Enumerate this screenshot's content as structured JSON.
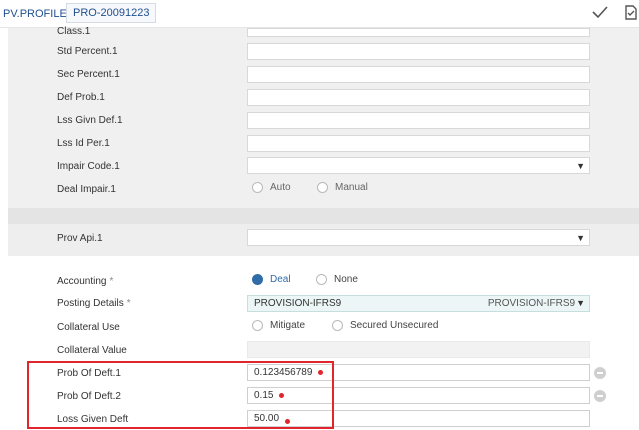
{
  "header": {
    "app_name": "PV.PROFILE",
    "record_id": "PRO-20091223",
    "commit_icon": "checkmark-icon",
    "doc_icon": "document-check-icon"
  },
  "fields": {
    "cutoff_label": "Class.1",
    "std_percent": {
      "label": "Std Percent.1",
      "value": ""
    },
    "sec_percent": {
      "label": "Sec Percent.1",
      "value": ""
    },
    "def_prob": {
      "label": "Def Prob.1",
      "value": ""
    },
    "lss_givn_def": {
      "label": "Lss Givn Def.1",
      "value": ""
    },
    "lss_id_per": {
      "label": "Lss Id Per.1",
      "value": ""
    },
    "impair_code": {
      "label": "Impair Code.1",
      "value": ""
    },
    "deal_impair": {
      "label": "Deal Impair.1",
      "options": [
        "Auto",
        "Manual"
      ]
    },
    "prov_api": {
      "label": "Prov Api.1",
      "value": ""
    },
    "accounting": {
      "label": "Accounting",
      "required_mark": "*",
      "options": [
        "Deal",
        "None"
      ],
      "selected": "Deal"
    },
    "posting_details": {
      "label": "Posting Details",
      "required_mark": "*",
      "value": "PROVISION-IFRS9",
      "display": "PROVISION-IFRS9"
    },
    "collateral_use": {
      "label": "Collateral Use",
      "options": [
        "Mitigate",
        "Secured Unsecured"
      ]
    },
    "collateral_value": {
      "label": "Collateral Value",
      "value": ""
    },
    "prob_of_deft_1": {
      "label": "Prob Of Deft.1",
      "value": "0.123456789"
    },
    "prob_of_deft_2": {
      "label": "Prob Of Deft.2",
      "value": "0.15"
    },
    "loss_given_deft": {
      "label": "Loss Given Deft",
      "value": "50.00"
    }
  },
  "colors": {
    "accent": "#2f6ca8",
    "highlight": "#e0262c",
    "panel": "#f0f0f0"
  }
}
